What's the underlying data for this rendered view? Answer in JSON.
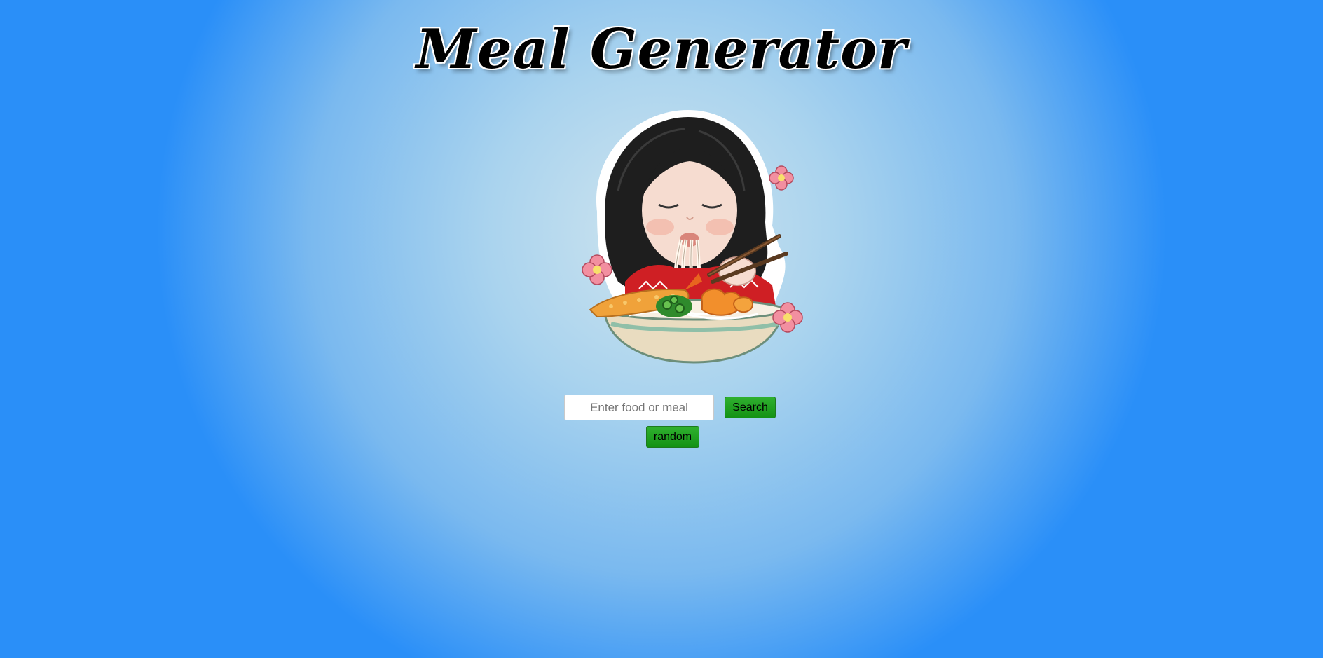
{
  "header": {
    "title": "Meal Generator"
  },
  "illustration": {
    "icon": "girl-eating-noodles-illustration"
  },
  "search": {
    "placeholder": "Enter food or meal",
    "value": "",
    "button_label": "Search"
  },
  "random": {
    "button_label": "random"
  },
  "colors": {
    "button_green": "#1f9e1f",
    "background_center": "#cfe4ee",
    "background_edge": "#2a8ff8"
  }
}
